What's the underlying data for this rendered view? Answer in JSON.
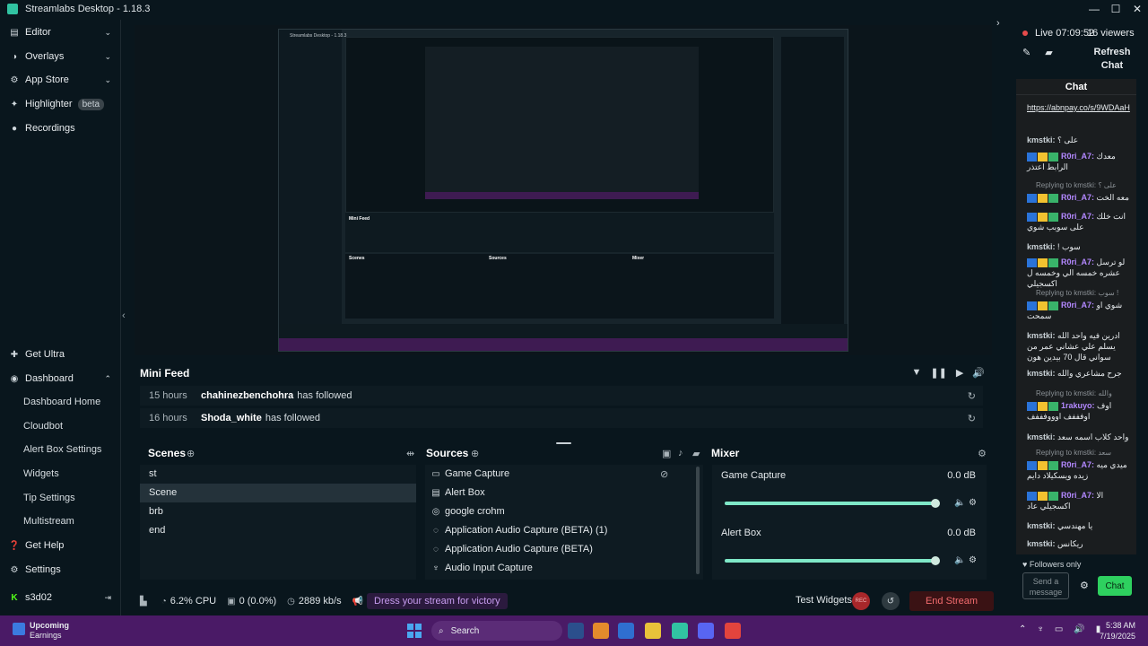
{
  "window": {
    "title": "Streamlabs Desktop - 1.18.3",
    "controls": [
      "—",
      "☐",
      "✕"
    ]
  },
  "sidebar": {
    "top": [
      {
        "label": "Editor",
        "icon": "editor-icon",
        "chevron": "⌄"
      },
      {
        "label": "Overlays",
        "icon": "overlays-icon",
        "chevron": "⌄"
      },
      {
        "label": "App Store",
        "icon": "app-store-icon",
        "chevron": "⌄"
      },
      {
        "label": "Highlighter",
        "icon": "highlighter-icon",
        "badge": "beta"
      },
      {
        "label": "Recordings",
        "icon": "recordings-icon"
      }
    ],
    "bottom": {
      "get_ultra": "Get Ultra",
      "dashboard": "Dashboard",
      "dashboard_items": [
        "Dashboard Home",
        "Cloudbot",
        "Alert Box Settings",
        "Widgets",
        "Tip Settings",
        "Multistream"
      ],
      "get_help": "Get Help",
      "settings": "Settings",
      "user": "s3d02"
    }
  },
  "preview": {
    "mini_title": "Streamlabs Desktop - 1.18.3",
    "mini_feed": "Mini Feed",
    "mini_scenes": "Scenes",
    "mini_sources": "Sources",
    "mini_mixer": "Mixer"
  },
  "mini_feed": {
    "title": "Mini Feed",
    "rows": [
      {
        "time": "15 hours",
        "user": "chahinezbenchohra",
        "action": "has followed"
      },
      {
        "time": "16 hours",
        "user": "Shoda_white",
        "action": "has followed"
      }
    ]
  },
  "scenes": {
    "title": "Scenes",
    "items": [
      "st",
      "Scene",
      "brb",
      "end"
    ],
    "active": "Scene"
  },
  "sources": {
    "title": "Sources",
    "items": [
      {
        "label": "Game Capture",
        "icon": "game-capture-icon"
      },
      {
        "label": "Alert Box",
        "icon": "alert-box-icon"
      },
      {
        "label": "google crohm",
        "icon": "browser-source-icon"
      },
      {
        "label": "Application Audio Capture (BETA) (1)",
        "icon": "audio-capture-icon"
      },
      {
        "label": "Application Audio Capture (BETA)",
        "icon": "audio-capture-icon"
      },
      {
        "label": "Audio Input Capture",
        "icon": "microphone-icon"
      }
    ]
  },
  "mixer": {
    "title": "Mixer",
    "channels": [
      {
        "name": "Game Capture",
        "db": "0.0 dB",
        "level": 0.98
      },
      {
        "name": "Alert Box",
        "db": "0.0 dB",
        "level": 0.98
      }
    ]
  },
  "status": {
    "cpu": "6.2% CPU",
    "dropped": "0 (0.0%)",
    "bitrate": "2889 kb/s",
    "promo": "Dress your stream for victory",
    "test_widgets": "Test Widgets",
    "rec": "REC",
    "end_stream": "End Stream"
  },
  "chat": {
    "live": "Live 07:09:52",
    "viewers": "16 viewers",
    "refresh": "Refresh Chat",
    "header": "Chat",
    "link": "https://abnpay.co/s/9WDAaH",
    "messages": [
      {
        "user": "kmstki:",
        "text": "على ؟"
      },
      {
        "user": "R0ri_A7:",
        "text": "معدك الرابط اعتذر"
      },
      {
        "reply": "Replying to kmstki: على ؟",
        "user": "R0ri_A7:",
        "text": "معه الخت"
      },
      {
        "user": "R0ri_A7:",
        "text": "انت خلك على سوبب شوي"
      },
      {
        "user": "kmstki:",
        "text": "! سوب"
      },
      {
        "user": "R0ri_A7:",
        "text": "لو ترسل عشره خمسه الي وخمسه ل اكسجيلي"
      },
      {
        "reply": "Replying to kmstki: سوب !",
        "user": "R0ri_A7:",
        "text": "شوي او سمحت"
      },
      {
        "user": "kmstki:",
        "text": "ادرين فيه واحد الله يسلم علي عشاني عمر من سواني قال 70 بيدين هون"
      },
      {
        "user": "kmstki:",
        "text": "جرح مشاعري والله"
      },
      {
        "reply": "Replying to kmstki: والله",
        "user": "1rakuyo:",
        "text": "اوف اوفففف اوووفففف"
      },
      {
        "user": "kmstki:",
        "text": "واحد كلاب اسمه سعد"
      },
      {
        "reply": "Replying to kmstki: سعد",
        "user": "R0ri_A7:",
        "text": "ميدي ميه زيده ويسكيلاد دايم"
      },
      {
        "user": "R0ri_A7:",
        "text": "الا اكسجيلي عاد"
      },
      {
        "user": "kmstki:",
        "text": "يا مهندسي"
      },
      {
        "user": "kmstki:",
        "text": "ريكانس"
      }
    ],
    "followers_only": "Followers only",
    "input_placeholder": "Send a message",
    "chat_button": "Chat"
  },
  "taskbar": {
    "weather_title": "Upcoming",
    "weather_sub": "Earnings",
    "search": "Search",
    "time": "5:38 AM",
    "date": "7/19/2025",
    "app_colors": [
      "#2b4f8c",
      "#e38b2c",
      "#2f6fd0",
      "#e8c23a",
      "#31c3a2",
      "#5865f2",
      "#e2443d"
    ]
  }
}
